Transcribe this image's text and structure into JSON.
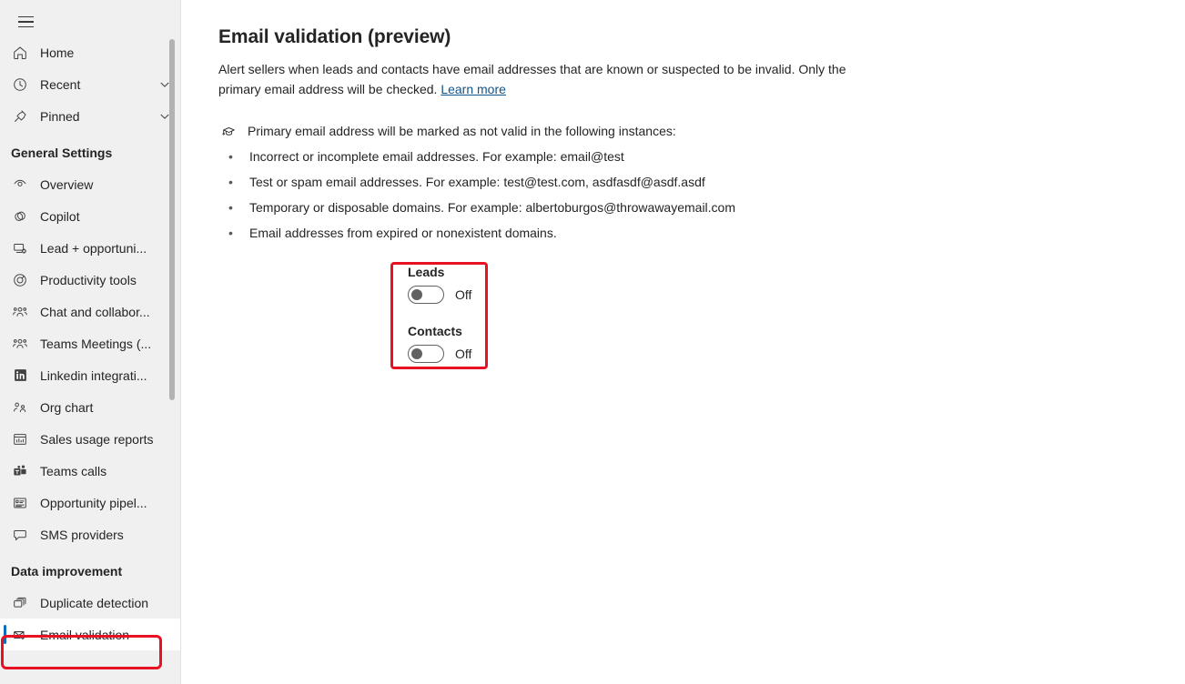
{
  "sidebar": {
    "menu_icon": "hamburger-icon",
    "top_items": [
      {
        "label": "Home",
        "icon": "home-icon",
        "chevron": false
      },
      {
        "label": "Recent",
        "icon": "clock-icon",
        "chevron": true
      },
      {
        "label": "Pinned",
        "icon": "pin-icon",
        "chevron": true
      }
    ],
    "groups": [
      {
        "header": "General Settings",
        "items": [
          {
            "label": "Overview",
            "icon": "eye-overview-icon"
          },
          {
            "label": "Copilot",
            "icon": "copilot-icon"
          },
          {
            "label": "Lead + opportuni...",
            "icon": "lead-opportunity-icon"
          },
          {
            "label": "Productivity tools",
            "icon": "gauge-icon"
          },
          {
            "label": "Chat and collabor...",
            "icon": "people-chat-icon"
          },
          {
            "label": "Teams Meetings (...",
            "icon": "people-meeting-icon"
          },
          {
            "label": "Linkedin integrati...",
            "icon": "linkedin-icon"
          },
          {
            "label": "Org chart",
            "icon": "org-chart-icon"
          },
          {
            "label": "Sales usage reports",
            "icon": "report-chart-icon"
          },
          {
            "label": "Teams calls",
            "icon": "teams-calls-icon"
          },
          {
            "label": "Opportunity pipel...",
            "icon": "pipeline-list-icon"
          },
          {
            "label": "SMS providers",
            "icon": "message-icon"
          }
        ]
      },
      {
        "header": "Data improvement",
        "items": [
          {
            "label": "Duplicate detection",
            "icon": "duplicate-icon"
          },
          {
            "label": "Email validation",
            "icon": "email-check-icon",
            "selected": true
          }
        ]
      }
    ]
  },
  "main": {
    "title": "Email validation (preview)",
    "description_line1": "Alert sellers when leads and contacts have email addresses that are known or suspected to be invalid.",
    "description_line2": "Only the primary email address will be checked.",
    "learn_more": "Learn more",
    "info_text": "Primary email address will be marked as not valid in the following instances:",
    "info_icon": "graduation-cap-icon",
    "bullets": [
      "Incorrect or incomplete email addresses. For example: email@test",
      "Test or spam email addresses. For example: test@test.com, asdfasdf@asdf.asdf",
      "Temporary or disposable domains. For example: albertoburgos@throwawayemail.com",
      "Email addresses from expired or nonexistent domains."
    ],
    "toggles": [
      {
        "label": "Leads",
        "state": "Off",
        "on": false
      },
      {
        "label": "Contacts",
        "state": "Off",
        "on": false
      }
    ]
  },
  "colors": {
    "accent": "#0f6cbd",
    "annotation": "#e81123",
    "link": "#0f548c",
    "sidebar_bg": "#f0f0f0",
    "text": "#242424"
  }
}
